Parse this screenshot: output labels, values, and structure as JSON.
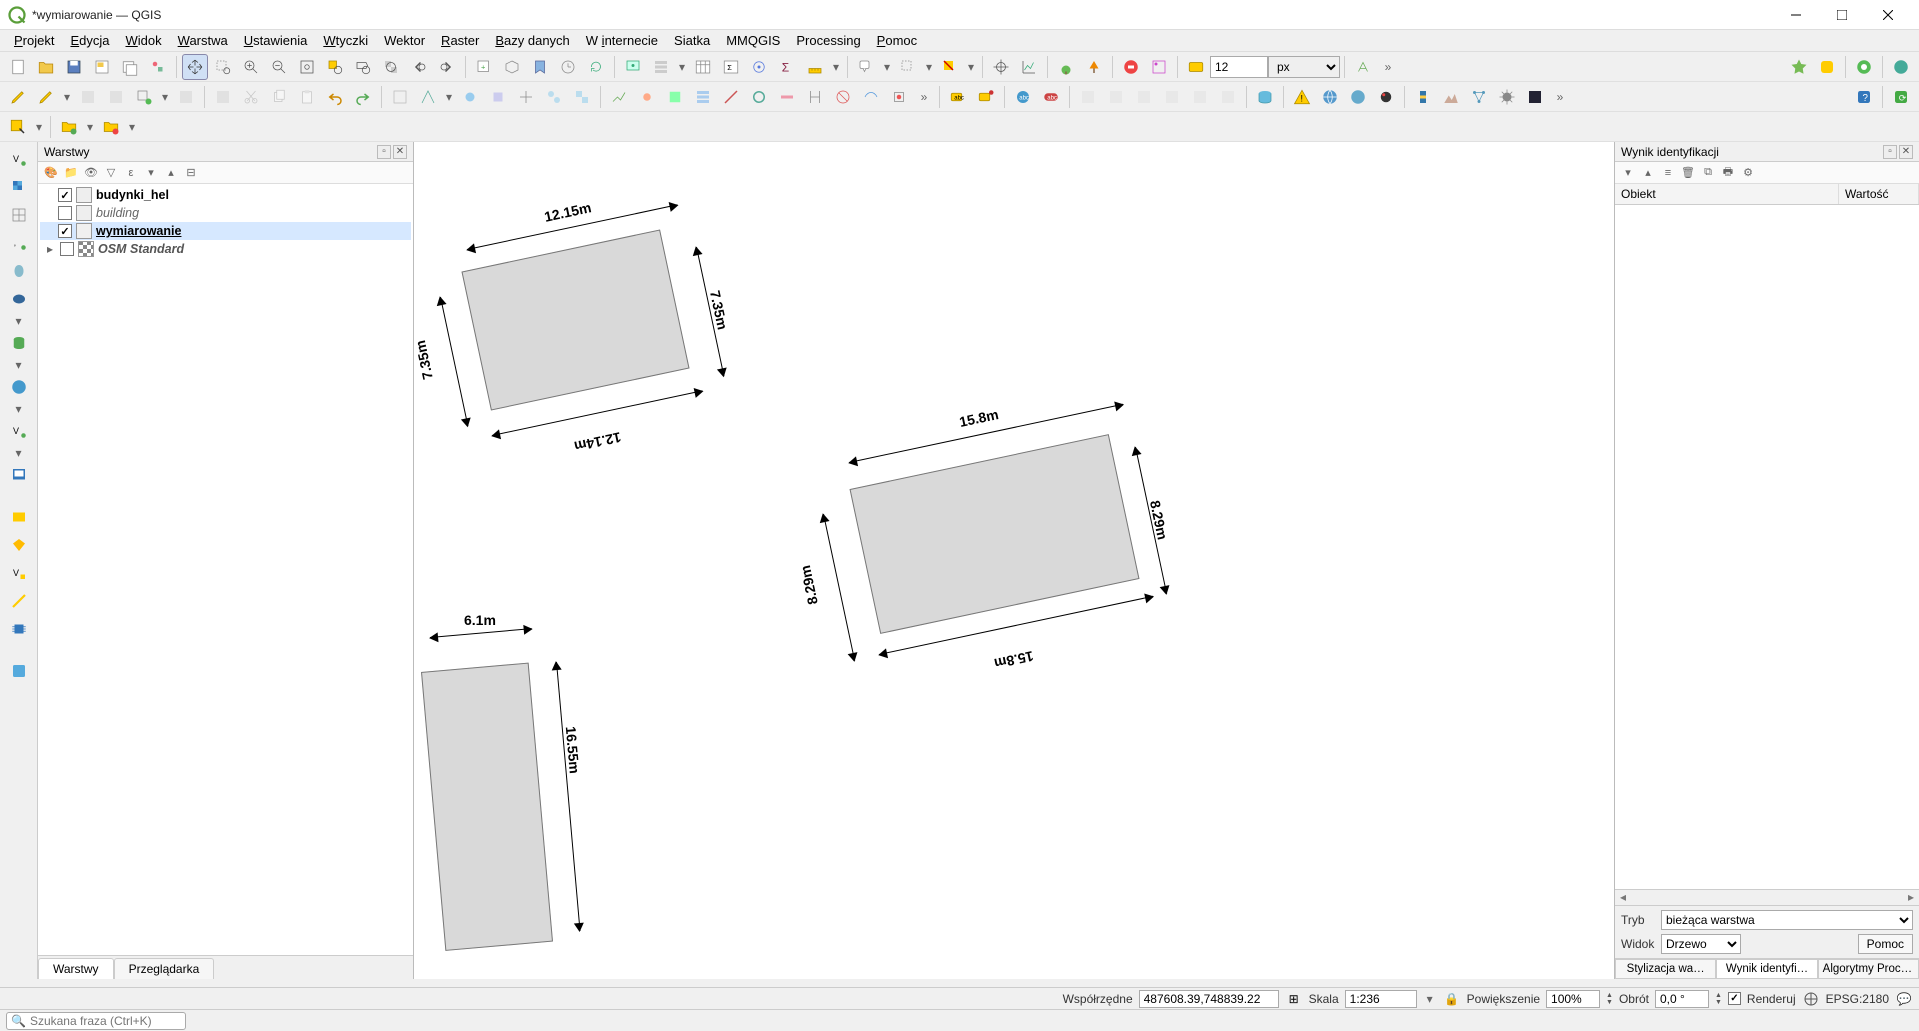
{
  "window": {
    "title": "*wymiarowanie — QGIS"
  },
  "menubar": {
    "items": [
      {
        "label": "Projekt",
        "u": 0
      },
      {
        "label": "Edycja",
        "u": 0
      },
      {
        "label": "Widok",
        "u": 0
      },
      {
        "label": "Warstwa",
        "u": 0
      },
      {
        "label": "Ustawienia",
        "u": 0
      },
      {
        "label": "Wtyczki",
        "u": 0
      },
      {
        "label": "Wektor",
        "u": -1
      },
      {
        "label": "Raster",
        "u": 0
      },
      {
        "label": "Bazy danych",
        "u": 0
      },
      {
        "label": "W internecie",
        "u": 2
      },
      {
        "label": "Siatka",
        "u": -1
      },
      {
        "label": "MMQGIS",
        "u": -1
      },
      {
        "label": "Processing",
        "u": -1
      },
      {
        "label": "Pomoc",
        "u": 0
      }
    ]
  },
  "toolbar_top": {
    "size_value": "12",
    "size_unit": "px"
  },
  "panels": {
    "layers": {
      "title": "Warstwy",
      "items": [
        {
          "checked": true,
          "name": "budynki_hel",
          "bold": true,
          "italic": false
        },
        {
          "checked": false,
          "name": "building",
          "bold": false,
          "italic": true
        },
        {
          "checked": true,
          "name": "wymiarowanie",
          "bold": true,
          "italic": false,
          "underline": true,
          "selected": true
        },
        {
          "checked": false,
          "name": "OSM Standard",
          "bold": true,
          "italic": true,
          "expand": true
        }
      ]
    },
    "bottom_tabs": {
      "t1": "Warstwy",
      "t2": "Przeglądarka"
    }
  },
  "identify": {
    "title": "Wynik identyfikacji",
    "col1": "Obiekt",
    "col2": "Wartość",
    "mode_label": "Tryb",
    "mode_value": "bieżąca warstwa",
    "view_label": "Widok",
    "view_value": "Drzewo",
    "help": "Pomoc",
    "tabs": {
      "t1": "Stylizacja wa…",
      "t2": "Wynik identyfi…",
      "t3": "Algorytmy Process…"
    }
  },
  "canvas": {
    "dims": {
      "b1_top": "12.15m",
      "b1_bottom": "12.14m",
      "b1_left": "7.35m",
      "b1_right": "7.35m",
      "b2_top": "15.8m",
      "b2_bottom": "15.8m",
      "b2_left": "8.29m",
      "b2_right": "8.29m",
      "b3_top": "6.1m",
      "b3_right": "16.55m"
    }
  },
  "status": {
    "coord_label": "Współrzędne",
    "coord_value": "487608.39,748839.22",
    "scale_label": "Skala",
    "scale_value": "1:236",
    "zoom_label": "Powiększenie",
    "zoom_value": "100%",
    "rot_label": "Obrót",
    "rot_value": "0,0 °",
    "render_label": "Renderuj",
    "crs": "EPSG:2180"
  },
  "search": {
    "placeholder": "Szukana fraza (Ctrl+K)"
  }
}
